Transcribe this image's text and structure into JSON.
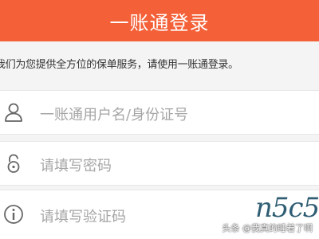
{
  "header": {
    "title": "一账通登录",
    "background_color": "#f46037"
  },
  "notice": {
    "text": "我们为您提供全方位的保单服务，请使用一账通登录。"
  },
  "fields": {
    "username": {
      "icon": "user-icon",
      "placeholder": "一账通用户名/身份证号"
    },
    "password": {
      "icon": "lock-icon",
      "placeholder": "请填写密码"
    },
    "captcha": {
      "icon": "info-icon",
      "placeholder": "请填写验证码",
      "image_text": "n5c5"
    }
  },
  "watermark": {
    "text": "头条 @我真的睡着了啊"
  }
}
